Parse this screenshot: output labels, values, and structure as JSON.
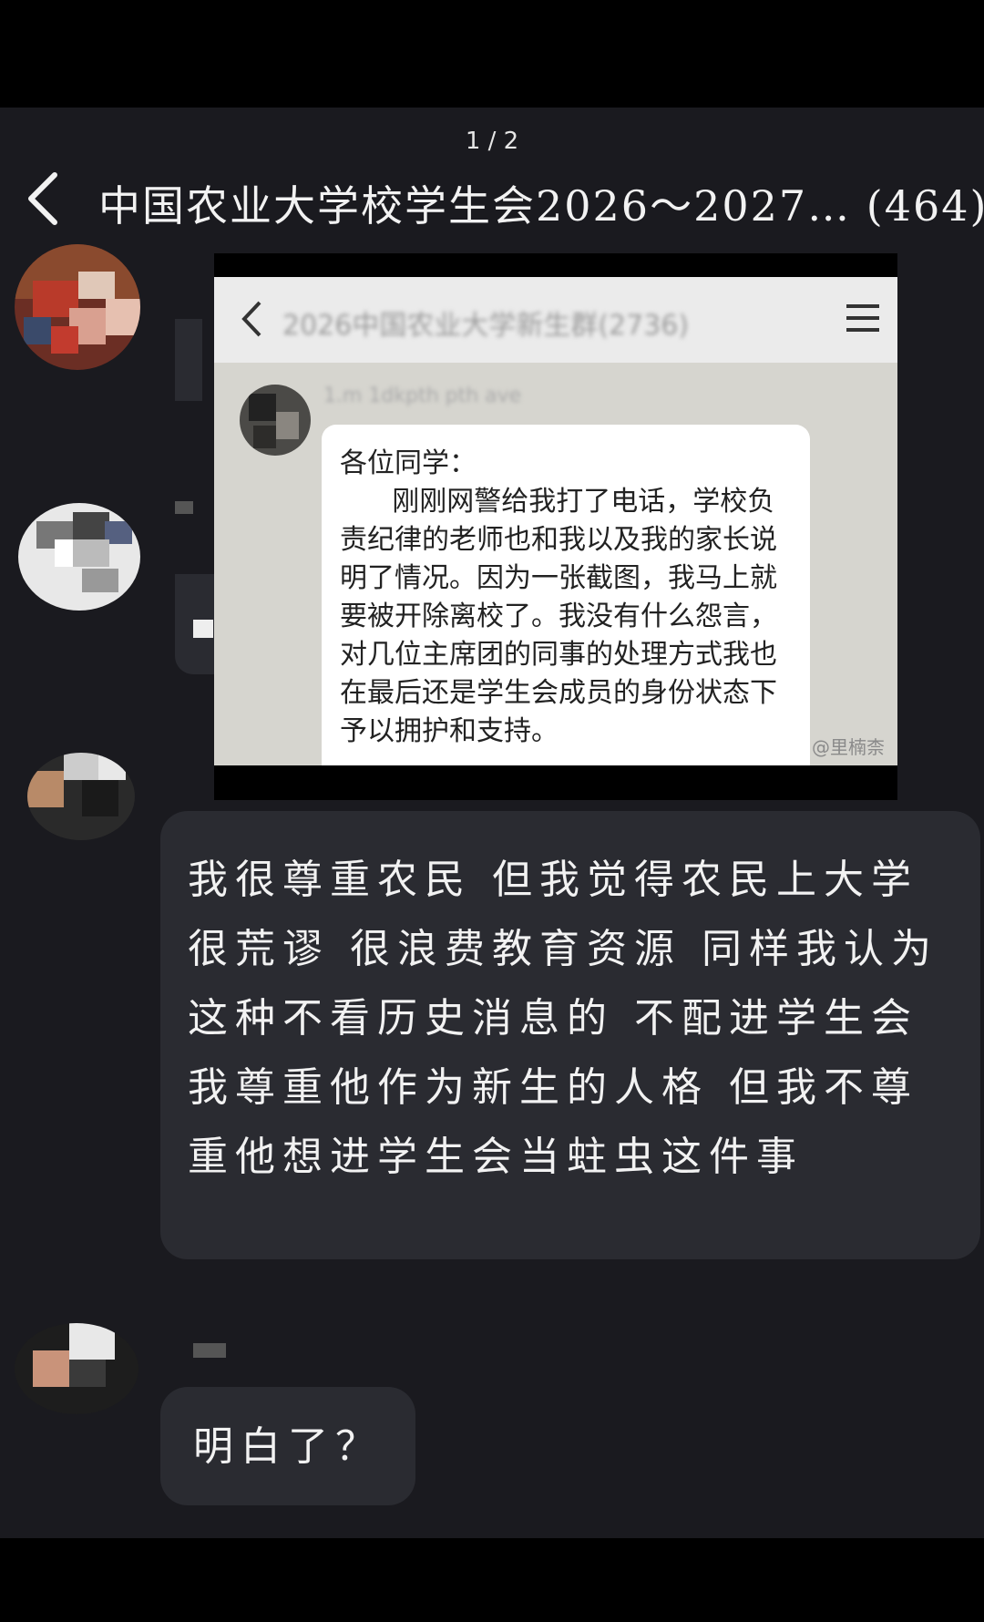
{
  "header": {
    "page_indicator": "1 / 2",
    "title": "中国农业大学校学生会2026～2027… (464)"
  },
  "embedded_screenshot": {
    "title": "2026中国农业大学新生群(2736)",
    "sender_name": "1.m 1dkpth  pth ave",
    "message": "各位同学：\n      刚刚网警给我打了电话，学校负责纪律的老师也和我以及我的家长说明了情况。因为一张截图，我马上就要被开除离校了。我没有什么怨言，对几位主席团的同事的处理方式我也在最后还是学生会成员的身份状态下予以拥护和支持。",
    "watermark": "@里楠柰"
  },
  "messages": [
    {
      "text": "我很尊重农民 但我觉得农民上大学很荒谬 很浪费教育资源 同样我认为这种不看历史消息的 不配进学生会 我尊重他作为新生的人格 但我不尊重他想进学生会当蛀虫这件事"
    },
    {
      "text": "明白了？"
    }
  ],
  "colors": {
    "background": "#1a1a1f",
    "bubble": "#2a2b31",
    "text": "#f2f2f2"
  }
}
